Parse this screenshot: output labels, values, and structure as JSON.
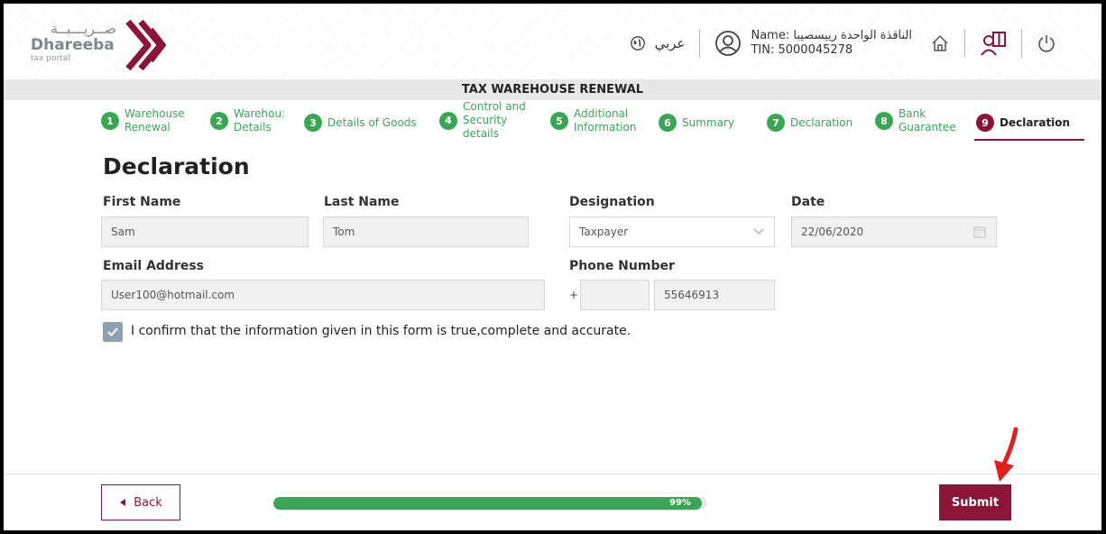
{
  "header": {
    "logo_arabic": "ضــريـــبــة",
    "logo_name": "Dhareeba",
    "logo_sub": "tax portal",
    "language_link": "عربي",
    "user_name": "Name: الناقذة الواحدة رييسصيبا",
    "user_tin": "TIN: 5000045278"
  },
  "page_title": "TAX WAREHOUSE RENEWAL",
  "steps": [
    {
      "num": "1",
      "label": "Warehouse\nRenewal"
    },
    {
      "num": "2",
      "label": "Warehou:\nDetails"
    },
    {
      "num": "3",
      "label": "Details of Goods"
    },
    {
      "num": "4",
      "label": "Control and\nSecurity\ndetails"
    },
    {
      "num": "5",
      "label": "Additional\nInformation"
    },
    {
      "num": "6",
      "label": "Summary"
    },
    {
      "num": "7",
      "label": "Declaration"
    },
    {
      "num": "8",
      "label": "Bank\nGuarantee"
    },
    {
      "num": "9",
      "label": "Declaration"
    }
  ],
  "form": {
    "section_title": "Declaration",
    "first_name_label": "First Name",
    "first_name_value": "Sam",
    "last_name_label": "Last Name",
    "last_name_value": "Tom",
    "designation_label": "Designation",
    "designation_value": "Taxpayer",
    "date_label": "Date",
    "date_value": "22/06/2020",
    "email_label": "Email Address",
    "email_value": "User100@hotmail.com",
    "phone_label": "Phone Number",
    "phone_prefix": "+",
    "phone_code": "",
    "phone_value": "55646913",
    "confirm_text": "I confirm that the information given in this form is true,complete and accurate.",
    "confirm_checked": true
  },
  "footer": {
    "back_label": "Back",
    "progress_value": 0.99,
    "progress_label": "99%",
    "submit_label": "Submit"
  },
  "colors": {
    "brand": "#8a1538",
    "step_green": "#3aa655",
    "progress_green": "#3aa655",
    "annotation_red": "#e02020"
  }
}
